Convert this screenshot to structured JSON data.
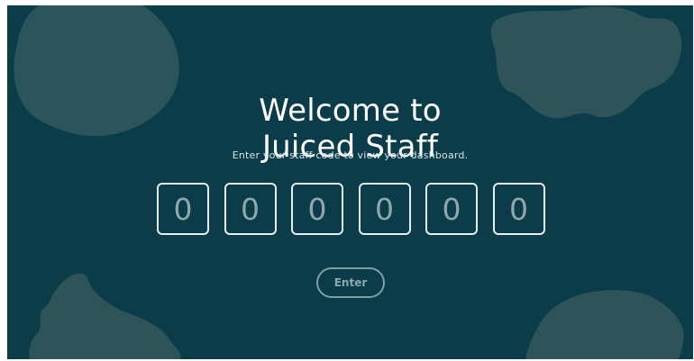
{
  "welcome": {
    "title_line1": "Welcome to",
    "title_line2": "Juiced Staff",
    "subtitle": "Enter your staff code to view your dashboard."
  },
  "code": {
    "digits": [
      "0",
      "0",
      "0",
      "0",
      "0",
      "0"
    ]
  },
  "actions": {
    "enter_label": "Enter"
  },
  "colors": {
    "background": "#0b3c4a",
    "blob": "#2b545d",
    "text": "#ffffff",
    "muted": "#8fa8ad",
    "border": "#e6eef0"
  }
}
